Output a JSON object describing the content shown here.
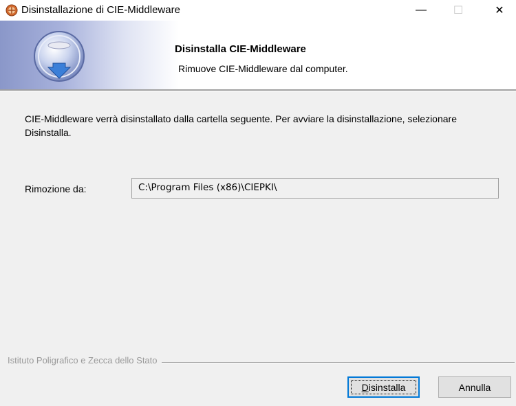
{
  "window": {
    "title": "Disinstallazione di CIE-Middleware",
    "minimize_glyph": "—",
    "maximize_glyph": "☐",
    "close_glyph": "✕"
  },
  "banner": {
    "title": "Disinstalla CIE-Middleware",
    "subtitle": "Rimuove CIE-Middleware dal computer."
  },
  "body": {
    "description": "CIE-Middleware verrà disinstallato dalla cartella seguente. Per avviare la disinstallazione, selezionare Disinstalla.",
    "from_label": "Rimozione da:",
    "path_value": "C:\\Program Files (x86)\\CIEPKI\\"
  },
  "footer": {
    "brand": "Istituto Poligrafico e Zecca dello Stato",
    "uninstall_mnemonic": "D",
    "uninstall_rest": "isinstalla",
    "cancel_label": "Annulla"
  },
  "icons": [
    "app-icon",
    "uninstall-disc-icon"
  ],
  "colors": {
    "accent": "#0078d7",
    "banner_gradient": "#8a97c9",
    "background": "#f0f0f0"
  }
}
